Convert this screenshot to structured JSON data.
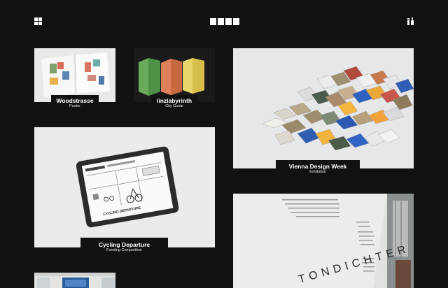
{
  "header": {
    "menu_icon": "grid-menu-icon",
    "logo_icon": "brand-logo-icon",
    "info_icon": "info-icon"
  },
  "projects": [
    {
      "title": "Woodstrasse",
      "subtitle": "Poster"
    },
    {
      "title": "linzlabyrinth",
      "subtitle": "City Guide"
    },
    {
      "title": "Vienna Design Week",
      "subtitle": "Exhibition"
    },
    {
      "title": "Cycling Departure",
      "subtitle": "Funding Competition"
    }
  ],
  "tablet_headline": "CYCLING DEPARTURE",
  "wall_text": "TONDICHTER",
  "colors": {
    "background": "#111111",
    "caption_bg": "#111111",
    "text": "#ffffff"
  }
}
